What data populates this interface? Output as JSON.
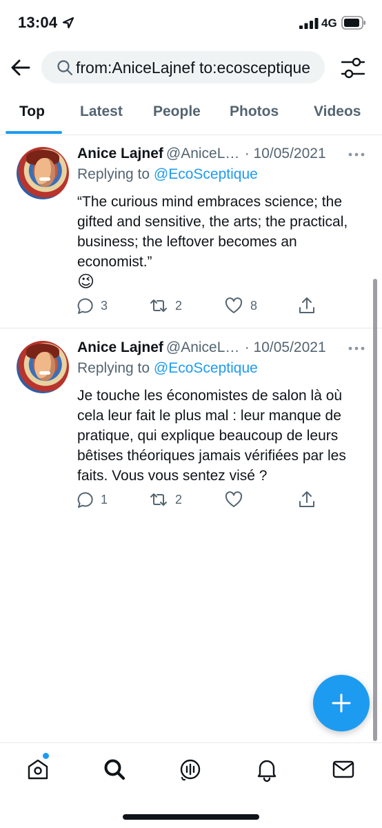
{
  "status_bar": {
    "time": "13:04",
    "network": "4G",
    "icons": [
      "location-arrow-icon",
      "signal-bars-icon",
      "battery-icon"
    ]
  },
  "search": {
    "query": "from:AniceLajnef to:ecosceptique",
    "icons": [
      "back-arrow-icon",
      "search-icon",
      "filter-sliders-icon"
    ]
  },
  "tabs": [
    {
      "label": "Top",
      "active": true
    },
    {
      "label": "Latest",
      "active": false
    },
    {
      "label": "People",
      "active": false
    },
    {
      "label": "Photos",
      "active": false
    },
    {
      "label": "Videos",
      "active": false
    }
  ],
  "tweets": [
    {
      "display_name": "Anice Lajnef",
      "handle": "@AniceLajnef",
      "date": "· 10/05/2021",
      "replying_prefix": "Replying to",
      "replying_to": "@EcoSceptique",
      "text": "“The curious mind embraces science; the gifted and sensitive, the arts; the practical, business; the leftover becomes an economist.”",
      "emoji": "😉",
      "replies": "3",
      "retweets": "2",
      "likes": "8"
    },
    {
      "display_name": "Anice Lajnef",
      "handle": "@AniceLajnef",
      "date": "· 10/05/2021",
      "replying_prefix": "Replying to",
      "replying_to": "@EcoSceptique",
      "text": "Je touche les économistes de salon là où cela leur fait le plus mal : leur manque de pratique, qui explique beaucoup de leurs bêtises théoriques jamais vérifiées par les faits. Vous vous sentez visé ?",
      "emoji": "",
      "replies": "1",
      "retweets": "2",
      "likes": ""
    }
  ],
  "fab": {
    "icon": "plus-icon"
  },
  "bottom_nav": [
    {
      "icon": "home-icon",
      "badge": true
    },
    {
      "icon": "search-icon",
      "active": true
    },
    {
      "icon": "spaces-icon"
    },
    {
      "icon": "bell-icon"
    },
    {
      "icon": "mail-icon"
    }
  ],
  "colors": {
    "accent": "#1d9bf0",
    "text_primary": "#0f1419",
    "text_secondary": "#536471",
    "search_bg": "#eff3f4"
  }
}
